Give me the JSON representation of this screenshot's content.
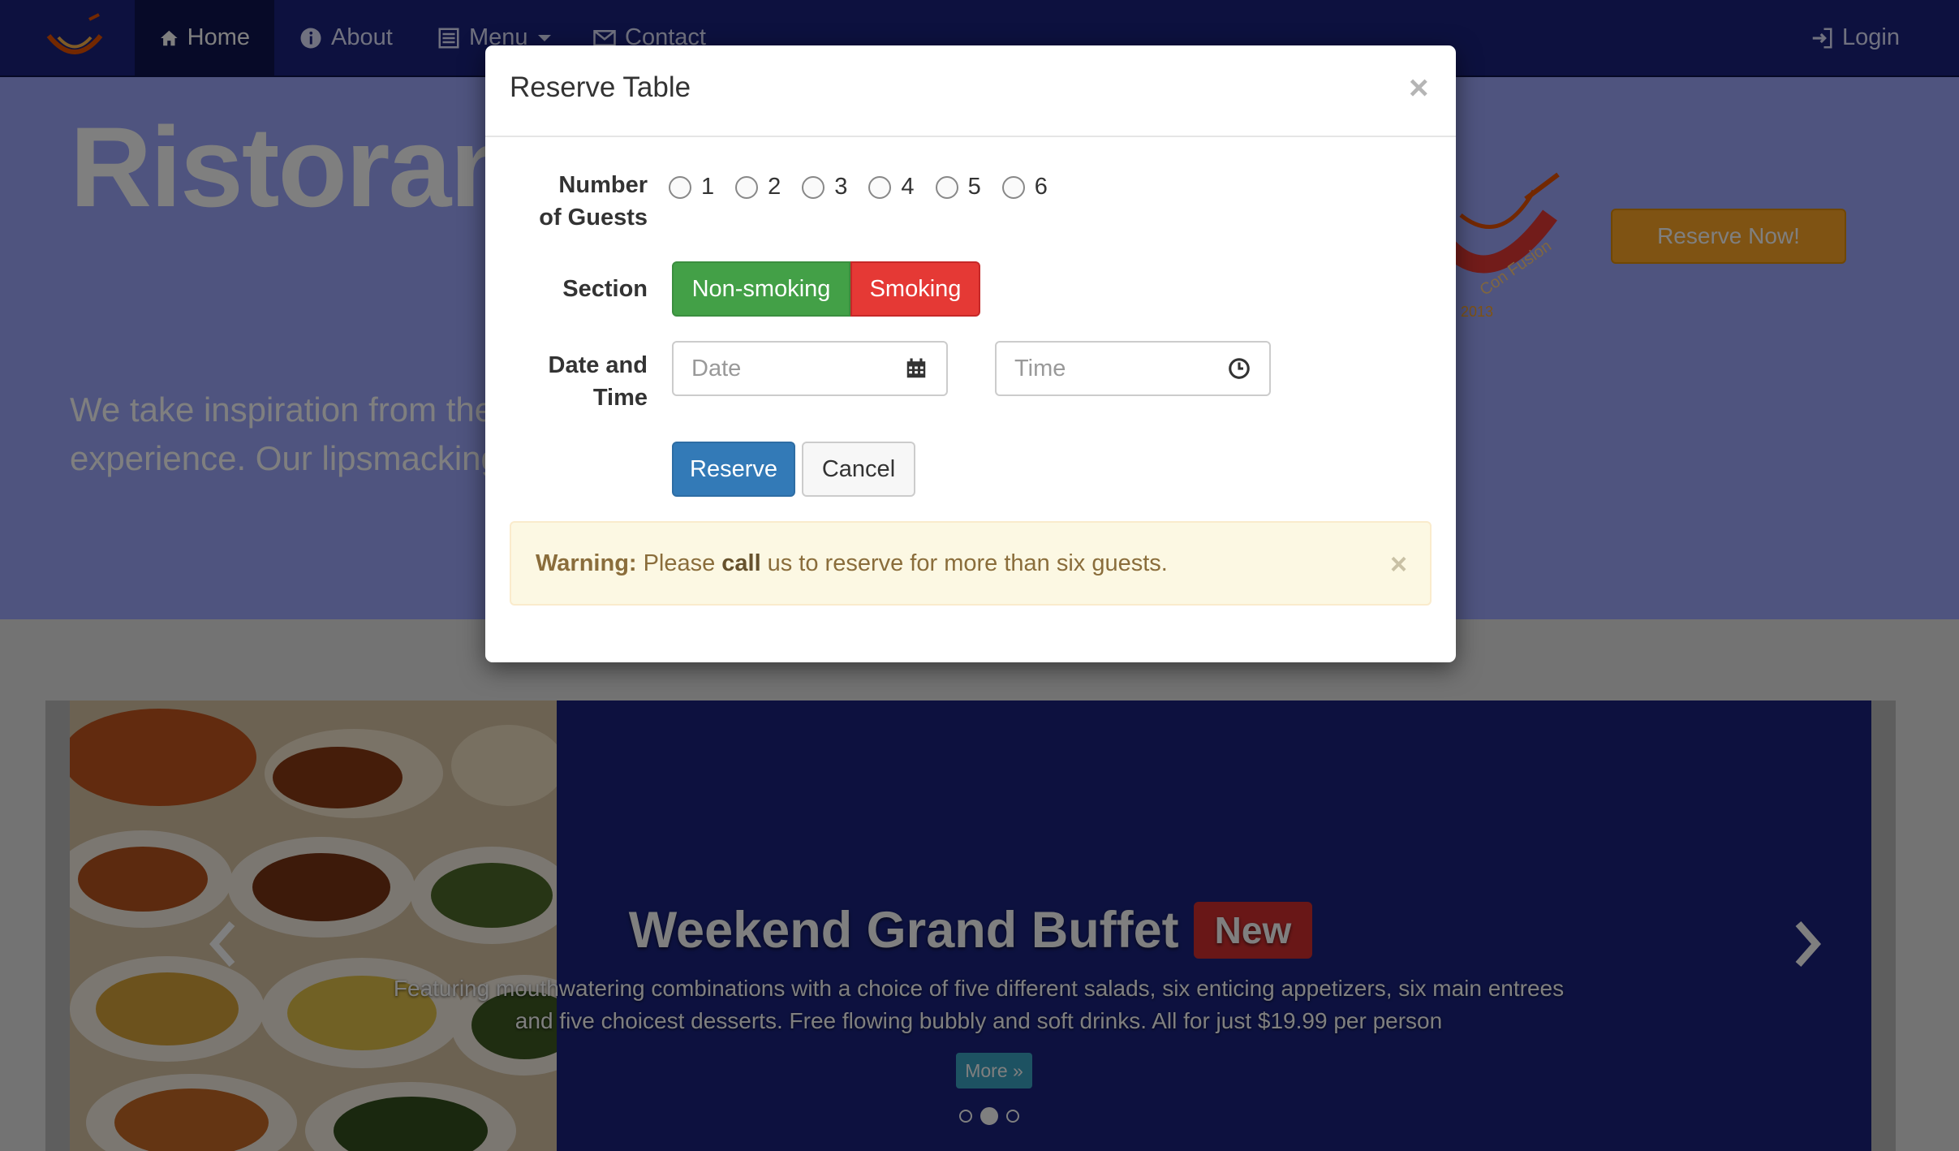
{
  "navbar": {
    "items": [
      {
        "label": "Home",
        "icon": "home-icon"
      },
      {
        "label": "About",
        "icon": "info-icon"
      },
      {
        "label": "Menu",
        "icon": "list-icon"
      },
      {
        "label": "Contact",
        "icon": "envelope-icon"
      }
    ],
    "login": {
      "label": "Login",
      "icon": "login-icon"
    }
  },
  "jumbotron": {
    "title": "Ristorante con Fusion",
    "text_line1": "We take inspiration from the World's best cuisines, and create a unique fusion",
    "text_line2": "experience. Our lipsmacking creations will tickle your culinary senses!",
    "logo_text": "Con Fusion",
    "logo_year": "2013",
    "reserve_button": "Reserve Now!"
  },
  "carousel": {
    "title": "Weekend Grand Buffet",
    "badge": "New",
    "text": "Featuring mouthwatering combinations with a choice of five different salads, six enticing appetizers, six main entrees and five choicest desserts. Free flowing bubbly and soft drinks. All for just $19.99 per person",
    "more_button": "More »",
    "active_slide": 2,
    "slide_count": 3
  },
  "modal": {
    "title": "Reserve Table",
    "close": "×",
    "guests_label_1": "Number",
    "guests_label_2": "of Guests",
    "guest_options": [
      "1",
      "2",
      "3",
      "4",
      "5",
      "6"
    ],
    "section_label": "Section",
    "section_options": {
      "non_smoking": "Non-smoking",
      "smoking": "Smoking"
    },
    "datetime_label_1": "Date and",
    "datetime_label_2": "Time",
    "date_placeholder": "Date",
    "time_placeholder": "Time",
    "reserve_button": "Reserve",
    "cancel_button": "Cancel",
    "alert": {
      "strong": "Warning:",
      "text_before": "Please",
      "emphasis": "call",
      "text_after": "us to reserve for more than six guests.",
      "close": "×"
    }
  },
  "colors": {
    "navbar": "#1a237e",
    "jumbotron": "#9fa8ff",
    "accent_orange": "#ffa726",
    "success": "#43a047",
    "danger": "#e53935",
    "primary": "#337ab7",
    "warning_bg": "#fcf8e3"
  }
}
